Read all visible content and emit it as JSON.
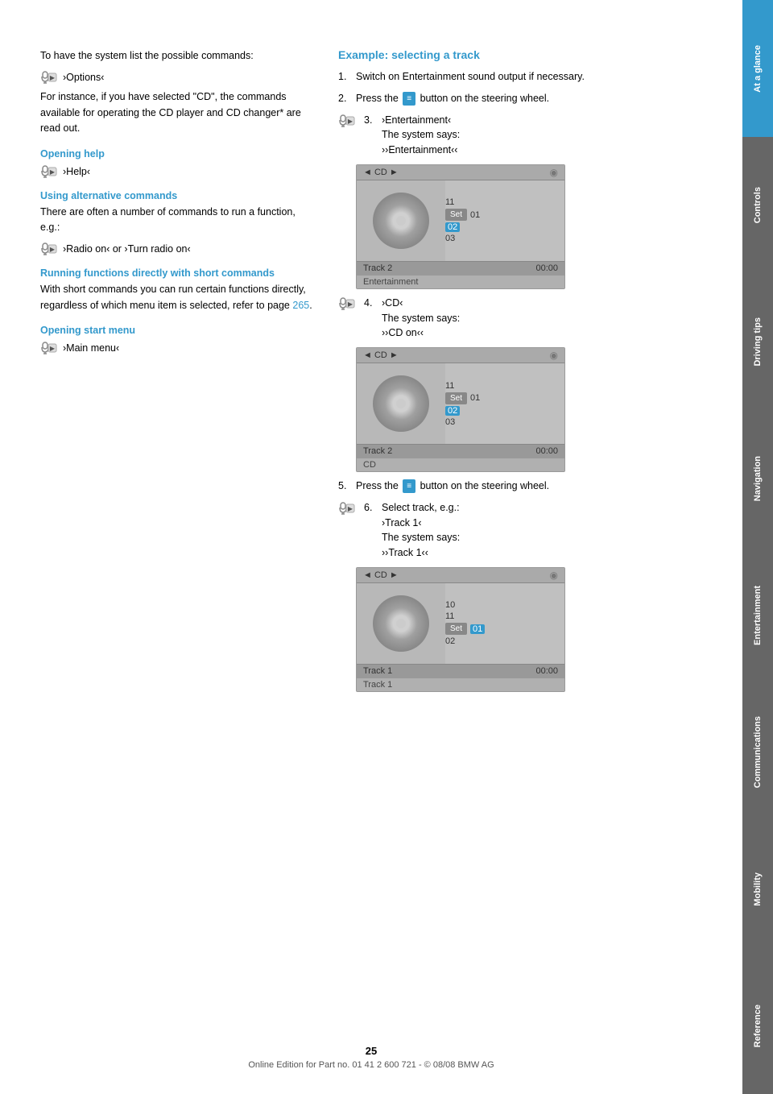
{
  "page": {
    "number": "25",
    "footer_text": "Online Edition for Part no. 01 41 2 600 721 - © 08/08 BMW AG"
  },
  "sidebar": {
    "tabs": [
      {
        "id": "at-a-glance",
        "label": "At a glance",
        "active": true
      },
      {
        "id": "controls",
        "label": "Controls",
        "active": false
      },
      {
        "id": "driving",
        "label": "Driving tips",
        "active": false
      },
      {
        "id": "navigation",
        "label": "Navigation",
        "active": false
      },
      {
        "id": "entertainment",
        "label": "Entertainment",
        "active": false
      },
      {
        "id": "communications",
        "label": "Communications",
        "active": false
      },
      {
        "id": "mobility",
        "label": "Mobility",
        "active": false
      },
      {
        "id": "reference",
        "label": "Reference",
        "active": false
      }
    ]
  },
  "left_col": {
    "intro_text": "To have the system list the possible commands:",
    "options_cmd": "›Options‹",
    "for_instance_text": "For instance, if you have selected \"CD\", the commands available for operating the CD player and CD changer* are read out.",
    "opening_help_heading": "Opening help",
    "help_cmd": "›Help‹",
    "using_alt_heading": "Using alternative commands",
    "using_alt_text": "There are often a number of commands to run a function, e.g.:",
    "radio_cmd": "›Radio on‹ or ›Turn radio on‹",
    "running_heading": "Running functions directly with short commands",
    "running_text": "With short commands you can run certain functions directly, regardless of which menu item is selected, refer to page",
    "running_page_ref": "265",
    "running_period": ".",
    "opening_start_heading": "Opening start menu",
    "main_menu_cmd": "›Main menu‹"
  },
  "right_col": {
    "example_heading": "Example: selecting a track",
    "steps": [
      {
        "num": "1.",
        "text": "Switch on Entertainment sound output if necessary."
      },
      {
        "num": "2.",
        "text": "Press the",
        "button": "≡",
        "text2": "button on the steering wheel."
      },
      {
        "num": "3.",
        "has_mic": true,
        "cmd": "›Entertainment‹",
        "says": "The system says:",
        "response": "››Entertainment‹‹"
      },
      {
        "num": "4.",
        "has_mic": true,
        "cmd": "›CD‹",
        "says": "The system says:",
        "response": "››CD on‹‹"
      },
      {
        "num": "5.",
        "text": "Press the",
        "button": "≡",
        "text2": "button on the steering wheel."
      },
      {
        "num": "6.",
        "has_mic": true,
        "cmd_label": "Select track, e.g.:",
        "cmd": "›Track 1‹",
        "says": "The system says:",
        "response": "››Track 1‹‹"
      }
    ],
    "screen1": {
      "header_left": "◄ CD ►",
      "tracks": [
        "11",
        "01",
        "02",
        "03"
      ],
      "selected_track": "02",
      "time": "00:00",
      "footer_label": "Track 2",
      "label_bar": "Entertainment"
    },
    "screen2": {
      "header_left": "◄ CD ►",
      "tracks": [
        "11",
        "01",
        "02",
        "03"
      ],
      "selected_track": "02",
      "time": "00:00",
      "footer_label": "Track 2",
      "label_bar": "CD"
    },
    "screen3": {
      "header_left": "◄ CD ►",
      "tracks": [
        "10",
        "11",
        "01",
        "02"
      ],
      "selected_track": "01",
      "time": "00:00",
      "footer_label": "Track 1",
      "label_bar": "Track 1"
    }
  }
}
